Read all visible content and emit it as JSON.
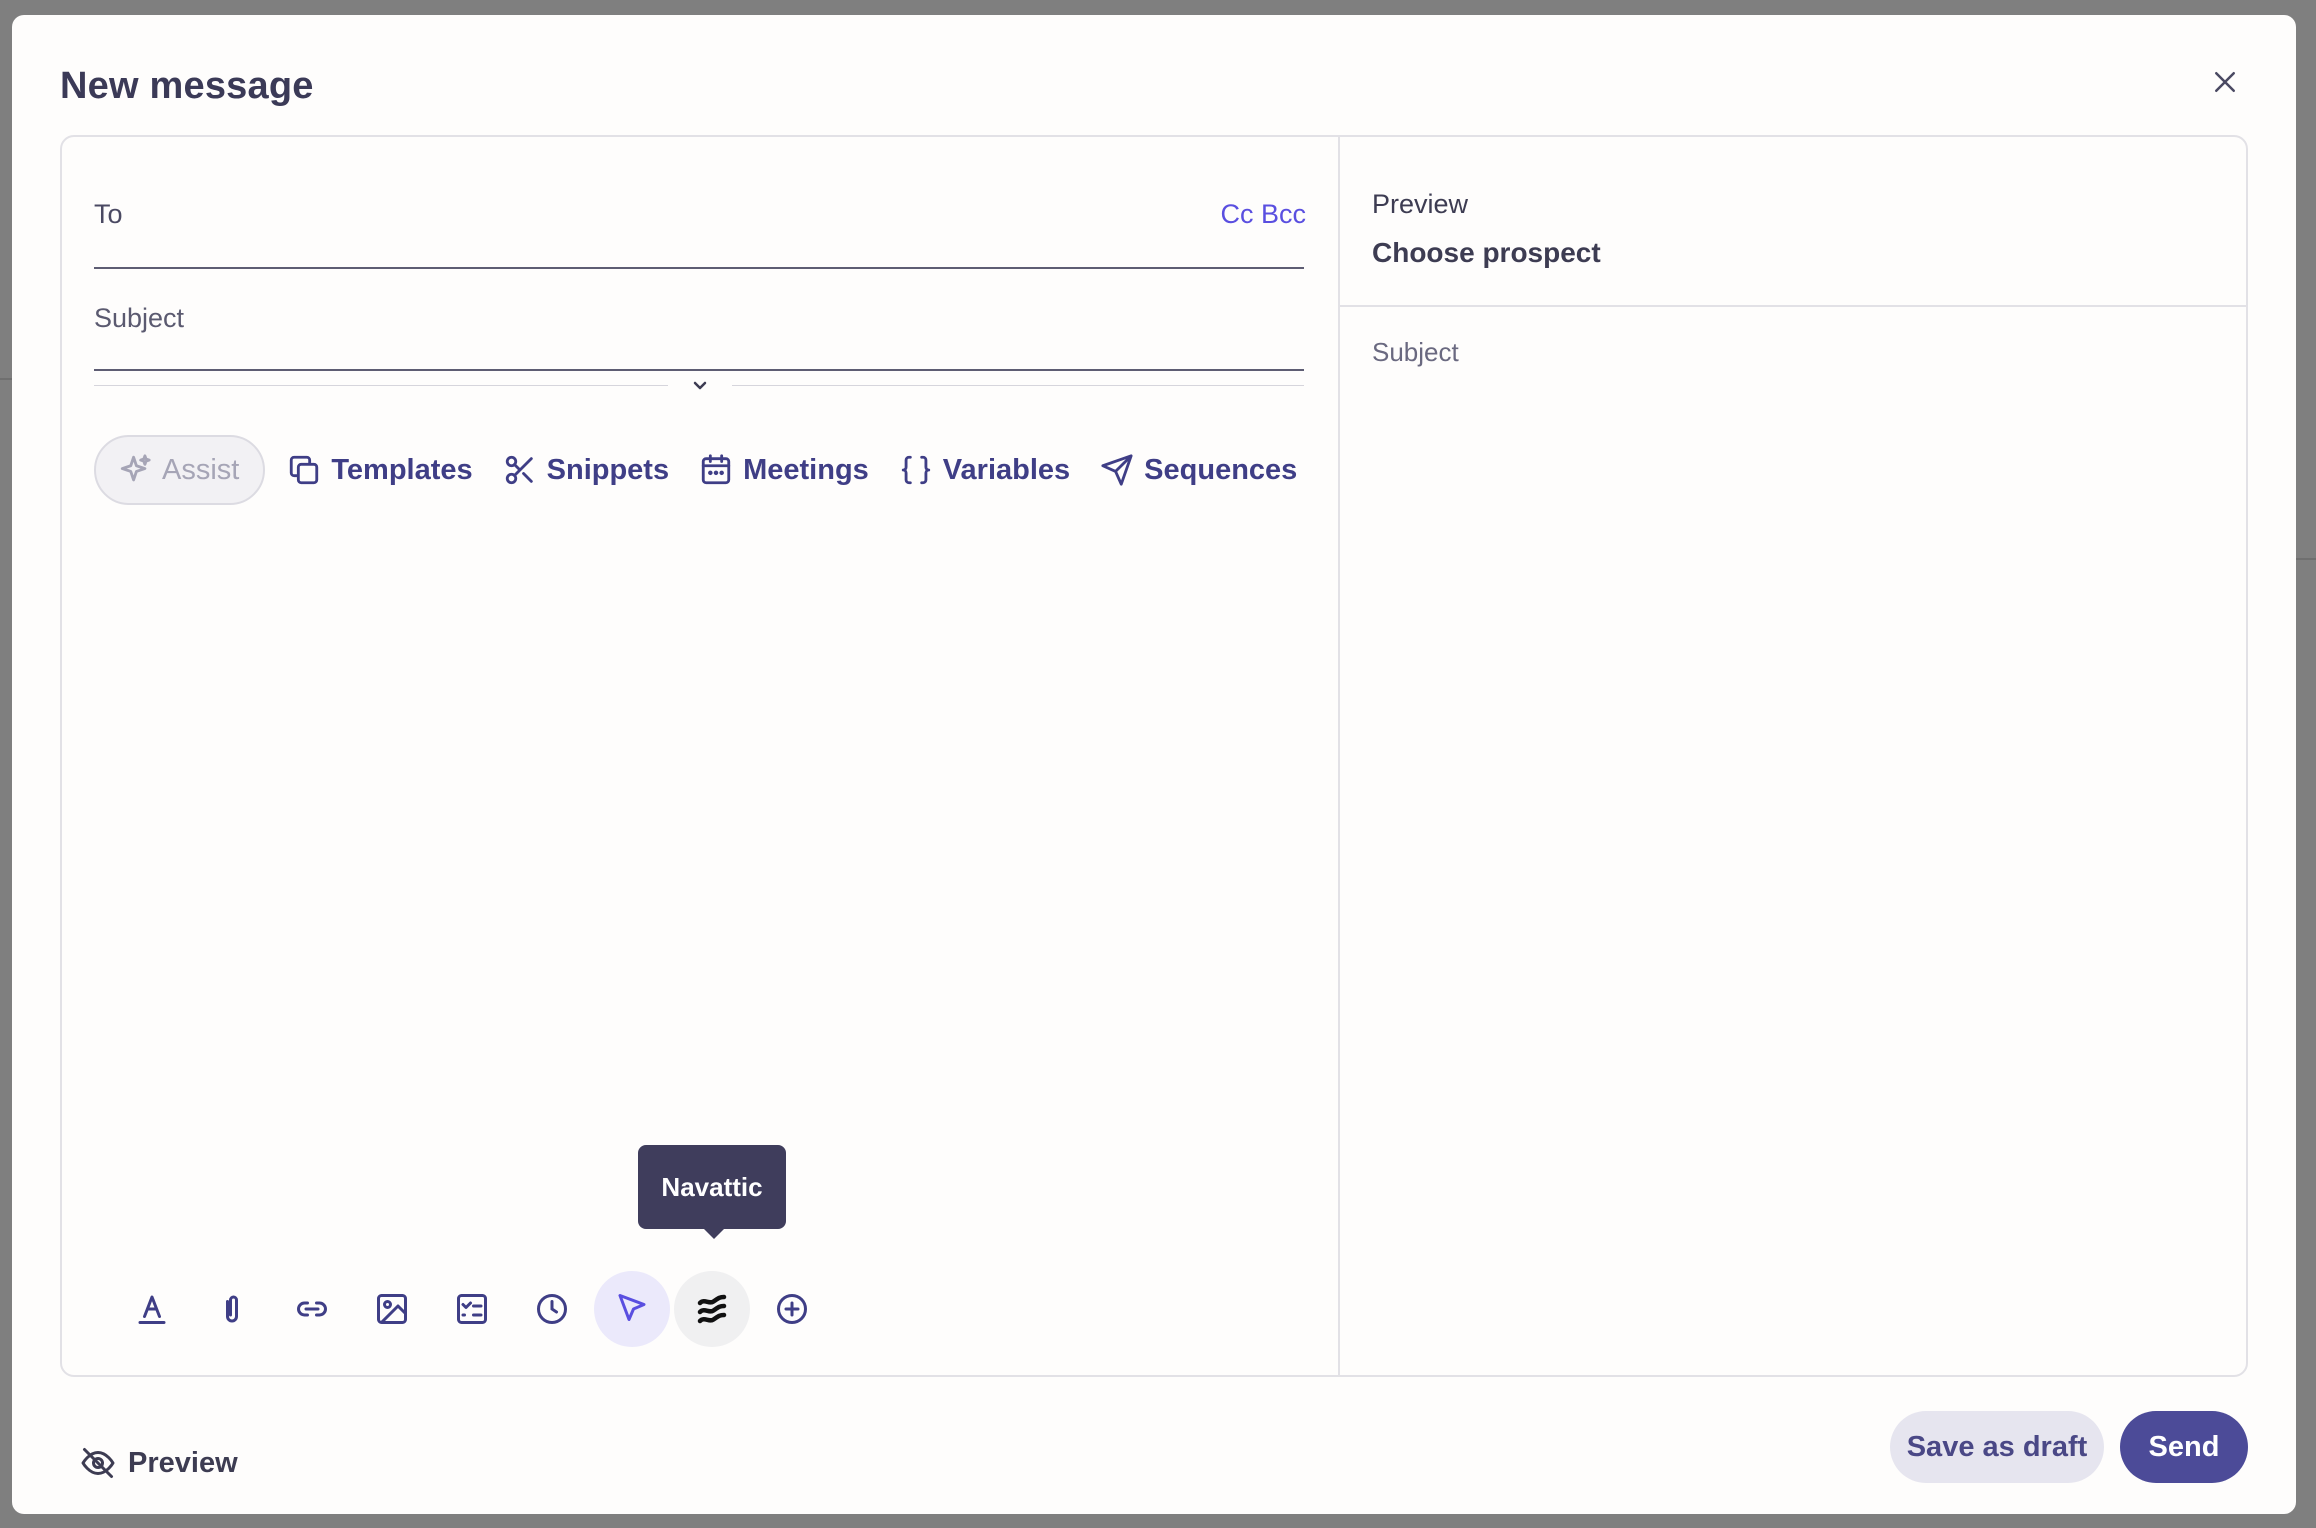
{
  "modal": {
    "title": "New message"
  },
  "compose": {
    "to_label": "To",
    "cc_bcc_label": "Cc Bcc",
    "subject_label": "Subject"
  },
  "toolbar": {
    "assist": "Assist",
    "templates": "Templates",
    "snippets": "Snippets",
    "meetings": "Meetings",
    "variables": "Variables",
    "sequences": "Sequences"
  },
  "tooltip": {
    "text": "Navattic"
  },
  "bottom_icons": [
    "text-format-icon",
    "paperclip-icon",
    "link-icon",
    "image-icon",
    "task-list-icon",
    "clock-icon",
    "cursor-icon",
    "navattic-icon",
    "add-circle-icon"
  ],
  "preview_panel": {
    "label": "Preview",
    "choose_prospect": "Choose prospect",
    "subject": "Subject"
  },
  "footer": {
    "preview": "Preview",
    "save_draft": "Save as draft",
    "send": "Send"
  },
  "colors": {
    "accent": "#4c4b98",
    "link": "#5a4fe0",
    "tooltip_bg": "#3f3d5c"
  }
}
